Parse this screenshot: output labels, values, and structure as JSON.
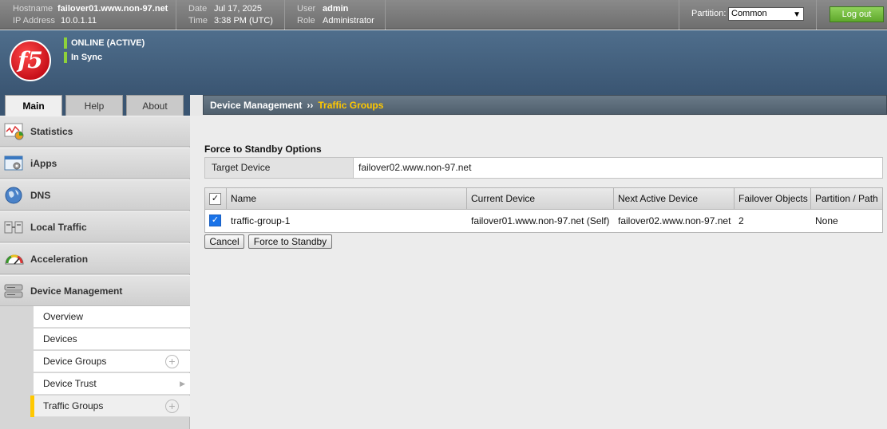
{
  "topbar": {
    "hostname_label": "Hostname",
    "hostname": "failover01.www.non-97.net",
    "ip_label": "IP Address",
    "ip": "10.0.1.11",
    "date_label": "Date",
    "date": "Jul 17, 2025",
    "time_label": "Time",
    "time": "3:38 PM (UTC)",
    "user_label": "User",
    "user": "admin",
    "role_label": "Role",
    "role": "Administrator",
    "partition_label": "Partition:",
    "partition_value": "Common",
    "logout_label": "Log out"
  },
  "brand": {
    "logo_text": "f5",
    "status_online": "ONLINE (ACTIVE)",
    "status_sync": "In Sync",
    "status_color": "#8ed13a"
  },
  "tabs": [
    {
      "label": "Main",
      "active": true
    },
    {
      "label": "Help",
      "active": false
    },
    {
      "label": "About",
      "active": false
    }
  ],
  "breadcrumb": {
    "parent": "Device Management",
    "separator": "››",
    "current": "Traffic Groups"
  },
  "sidebar": {
    "items": [
      {
        "label": "Statistics",
        "icon": "statistics-chart-icon"
      },
      {
        "label": "iApps",
        "icon": "iapps-window-icon"
      },
      {
        "label": "DNS",
        "icon": "dns-globe-icon"
      },
      {
        "label": "Local Traffic",
        "icon": "local-traffic-icon"
      },
      {
        "label": "Acceleration",
        "icon": "acceleration-gauge-icon"
      },
      {
        "label": "Device Management",
        "icon": "device-management-server-icon"
      }
    ],
    "subitems": [
      {
        "label": "Overview"
      },
      {
        "label": "Devices"
      },
      {
        "label": "Device Groups"
      },
      {
        "label": "Device Trust"
      },
      {
        "label": "Traffic Groups"
      }
    ]
  },
  "content": {
    "section_title": "Force to Standby Options",
    "target_label": "Target Device",
    "target_value": "failover02.www.non-97.net",
    "table": {
      "headers": [
        "Name",
        "Current Device",
        "Next Active Device",
        "Failover Objects",
        "Partition / Path"
      ],
      "rows": [
        {
          "checked": true,
          "name": "traffic-group-1",
          "current_device": "failover01.www.non-97.net (Self)",
          "next_active_device": "failover02.www.non-97.net",
          "failover_objects": "2",
          "partition_path": "None"
        }
      ]
    },
    "cancel_label": "Cancel",
    "force_label": "Force to Standby"
  }
}
